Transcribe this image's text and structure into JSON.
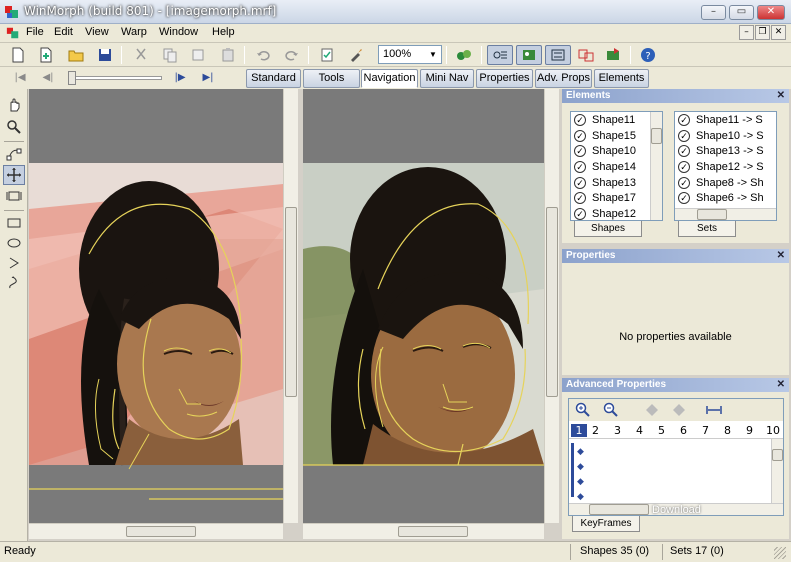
{
  "window": {
    "title": "WinMorph (build 801) - [imagemorph.mrf]"
  },
  "menu": [
    "File",
    "Edit",
    "View",
    "Warp",
    "Window",
    "Help"
  ],
  "toolbar": {
    "zoom": "100%"
  },
  "tabs": [
    "Standard",
    "Tools",
    "Navigation",
    "Mini Nav",
    "Properties",
    "Adv. Props",
    "Elements"
  ],
  "active_tab": "Navigation",
  "elements_panel": {
    "title": "Elements",
    "shapes": [
      "Shape11",
      "Shape15",
      "Shape10",
      "Shape14",
      "Shape13",
      "Shape17",
      "Shape12"
    ],
    "sets": [
      "Shape11 -> S",
      "Shape10 -> S",
      "Shape13 -> S",
      "Shape12 -> S",
      "Shape8 -> Sh",
      "Shape6 -> Sh"
    ],
    "shapes_tab": "Shapes",
    "sets_tab": "Sets"
  },
  "properties_panel": {
    "title": "Properties",
    "empty_text": "No properties available"
  },
  "advanced_panel": {
    "title": "Advanced Properties",
    "frames": [
      "1",
      "2",
      "3",
      "4",
      "5",
      "6",
      "7",
      "8",
      "9",
      "10"
    ],
    "keyframes_tab": "KeyFrames",
    "watermark": "Download"
  },
  "status": {
    "left": "Ready",
    "shapes": "Shapes 35 (0)",
    "sets": "Sets 17 (0)"
  },
  "colors": {
    "accent": "#8ca2cc",
    "outline": "#e6d35a",
    "pane_bg": "#7a7a7a"
  },
  "icons": [
    "app-icon",
    "new-icon",
    "add-icon",
    "open-icon",
    "save-icon",
    "cut-icon",
    "copy-icon",
    "paste-icon",
    "undo-icon",
    "redo-icon",
    "properties-icon",
    "brush-icon",
    "morph-icon",
    "shapes-icon",
    "sets-icon",
    "compare-icon",
    "export-icon",
    "help-icon"
  ]
}
